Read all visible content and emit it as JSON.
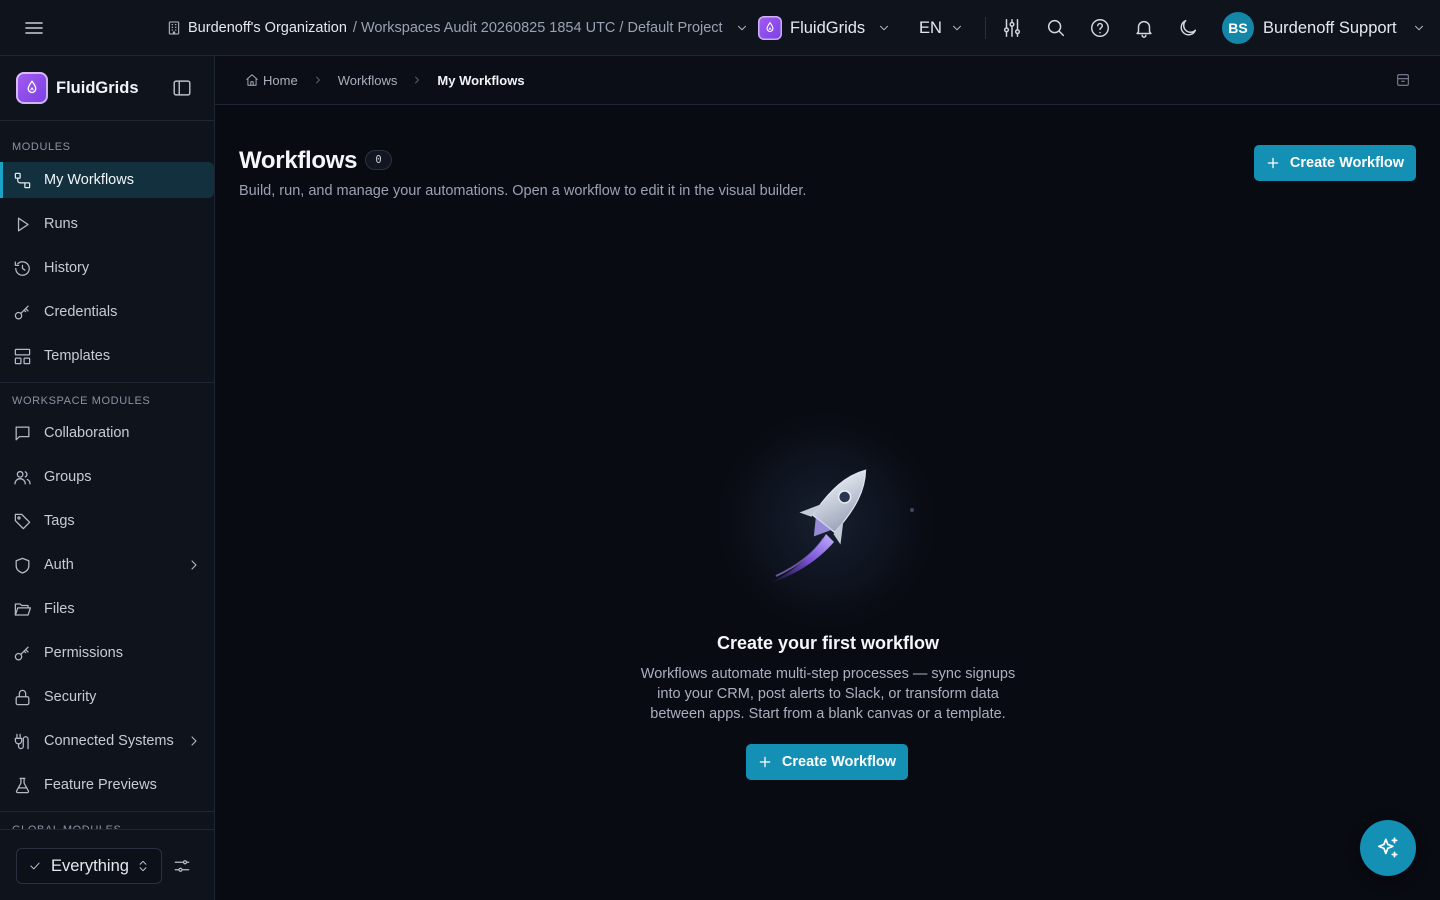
{
  "topbar": {
    "org_name": "Burdenoff's Organization",
    "org_path": "/ Workspaces Audit 20260825 1854 UTC / Default Project",
    "app_name": "FluidGrids",
    "language": "EN",
    "user_initials": "BS",
    "user_name": "Burdenoff Support"
  },
  "sidebar": {
    "brand": "FluidGrids",
    "modules_label": "MODULES",
    "modules": [
      {
        "label": "My Workflows",
        "icon": "workflow-icon"
      },
      {
        "label": "Runs",
        "icon": "play-icon"
      },
      {
        "label": "History",
        "icon": "history-icon"
      },
      {
        "label": "Credentials",
        "icon": "key-icon"
      },
      {
        "label": "Templates",
        "icon": "templates-icon"
      }
    ],
    "workspace_label": "WORKSPACE MODULES",
    "workspace_modules": [
      {
        "label": "Collaboration",
        "icon": "message-icon"
      },
      {
        "label": "Groups",
        "icon": "users-icon"
      },
      {
        "label": "Tags",
        "icon": "tag-icon"
      },
      {
        "label": "Auth",
        "icon": "shield-icon"
      },
      {
        "label": "Files",
        "icon": "folder-open-icon"
      },
      {
        "label": "Permissions",
        "icon": "key-icon"
      },
      {
        "label": "Security",
        "icon": "lock-icon"
      },
      {
        "label": "Connected Systems",
        "icon": "plug-icon"
      },
      {
        "label": "Feature Previews",
        "icon": "flask-icon"
      }
    ],
    "global_label": "GLOBAL MODULES",
    "filter_value": "Everything"
  },
  "breadcrumb": {
    "home": "Home",
    "workflows": "Workflows",
    "current": "My Workflows"
  },
  "main": {
    "title": "Workflows",
    "count": "0",
    "subtitle": "Build, run, and manage your automations. Open a workflow to edit it in the visual builder.",
    "create_label": "Create Workflow"
  },
  "empty_state": {
    "title": "Create your first workflow",
    "description": "Workflows automate multi-step processes — sync signups into your CRM, post alerts to Slack, or transform data between apps. Start from a blank canvas or a template.",
    "button_label": "Create Workflow"
  },
  "colors": {
    "accent": "#1490b5",
    "brand_purple": "#8b4bea",
    "background": "#090b12",
    "panel": "#0f131c"
  }
}
